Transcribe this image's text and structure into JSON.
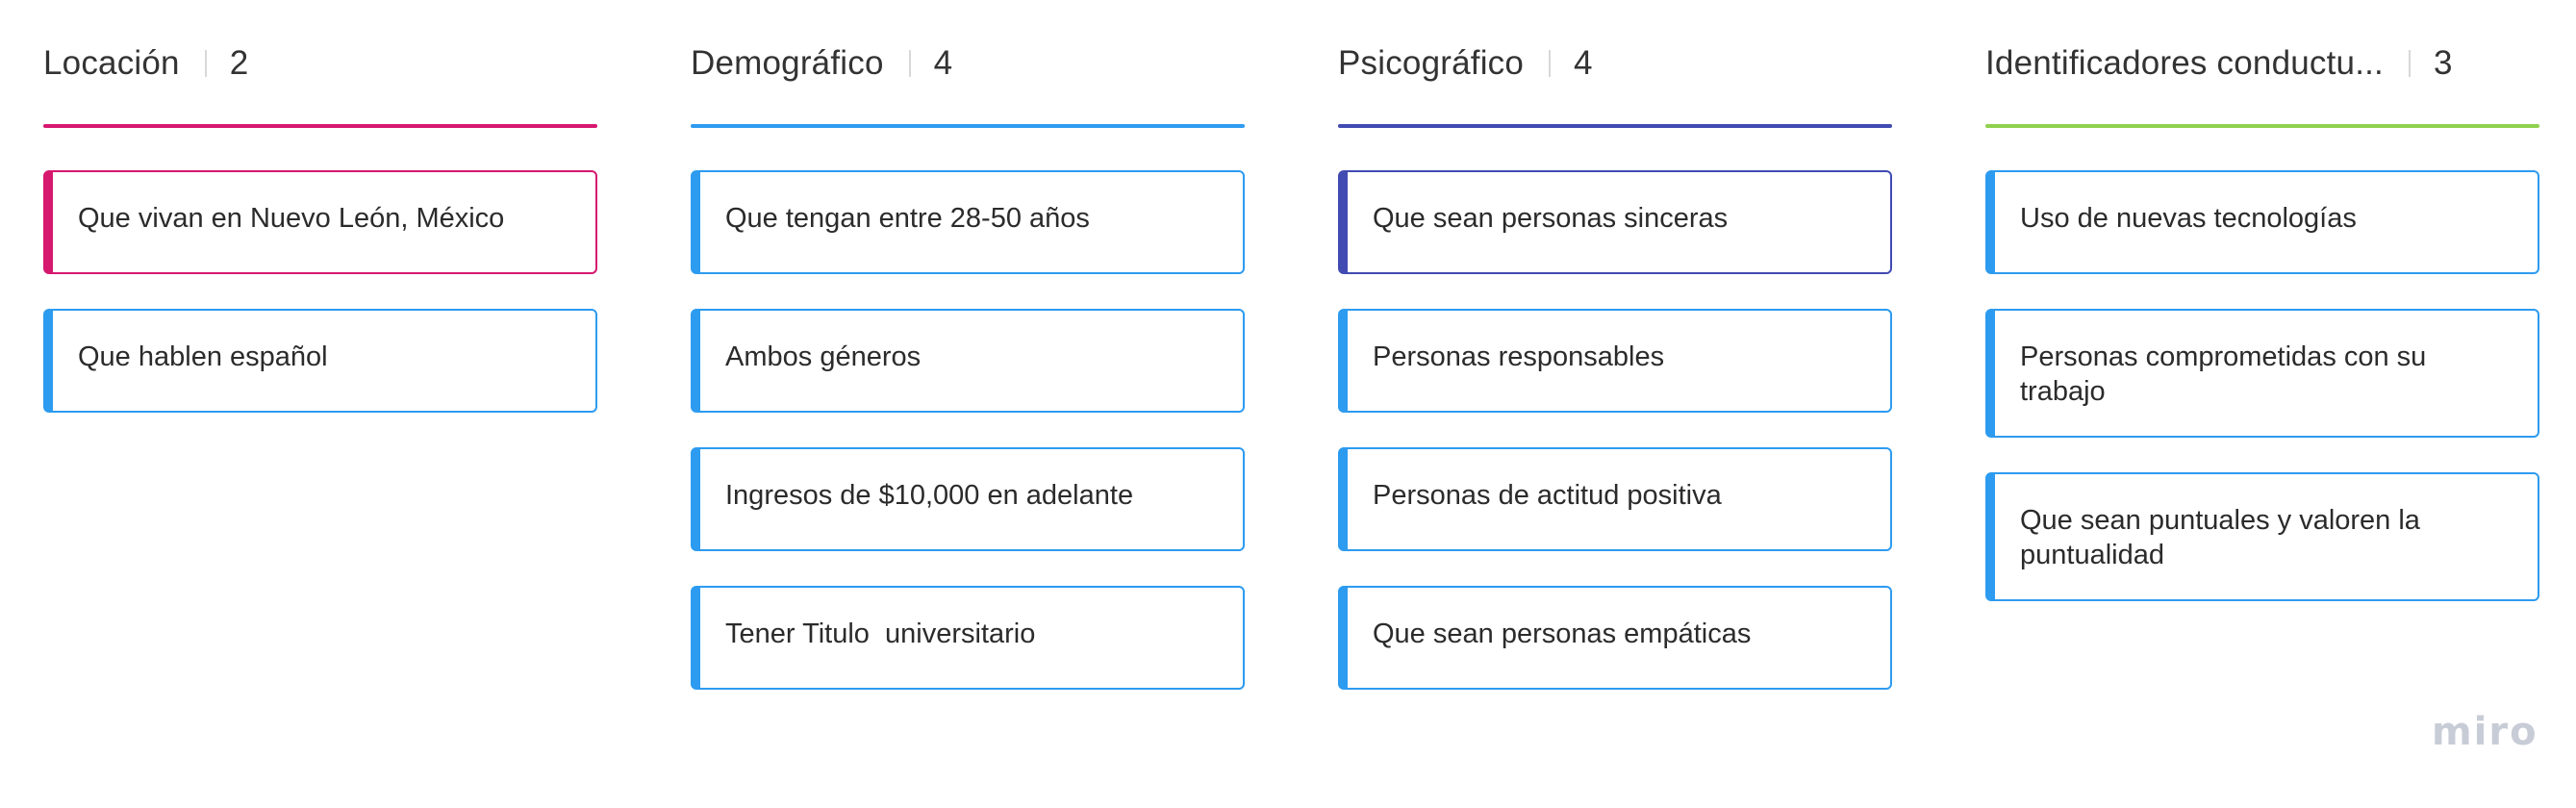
{
  "columns": [
    {
      "title": "Locación",
      "count": "2",
      "accent": "#d6186f",
      "cards": [
        {
          "text": "Que vivan en Nuevo León, México",
          "color": "#d6186f"
        },
        {
          "text": "Que hablen español",
          "color": "#2d9bf0"
        }
      ]
    },
    {
      "title": "Demográfico",
      "count": "4",
      "accent": "#2d9bf0",
      "cards": [
        {
          "text": "Que tengan entre 28-50 años",
          "color": "#2d9bf0"
        },
        {
          "text": "Ambos géneros",
          "color": "#2d9bf0"
        },
        {
          "text": "Ingresos de $10,000 en adelante",
          "color": "#2d9bf0"
        },
        {
          "text": "Tener Titulo  universitario",
          "color": "#2d9bf0"
        }
      ]
    },
    {
      "title": "Psicográfico",
      "count": "4",
      "accent": "#414bb2",
      "cards": [
        {
          "text": "Que sean personas sinceras",
          "color": "#414bb2"
        },
        {
          "text": "Personas responsables",
          "color": "#2d9bf0"
        },
        {
          "text": "Personas de actitud positiva",
          "color": "#2d9bf0"
        },
        {
          "text": "Que sean personas empáticas",
          "color": "#2d9bf0"
        }
      ]
    },
    {
      "title": "Identificadores conductu...",
      "count": "3",
      "accent": "#8fd14f",
      "cards": [
        {
          "text": "Uso de nuevas tecnologías",
          "color": "#2d9bf0"
        },
        {
          "text": "Personas comprometidas con su trabajo",
          "color": "#2d9bf0"
        },
        {
          "text": "Que sean puntuales y valoren la puntualidad",
          "color": "#2d9bf0"
        }
      ]
    }
  ],
  "branding": {
    "logo_text": "miro"
  }
}
